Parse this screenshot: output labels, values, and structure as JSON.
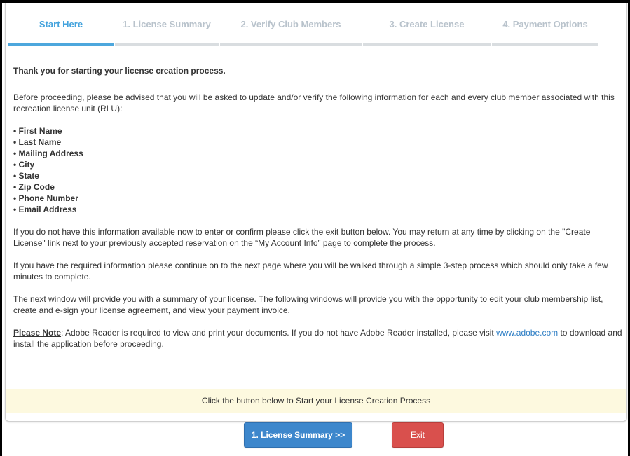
{
  "tabs": [
    {
      "label": "Start Here",
      "active": true
    },
    {
      "label": "1. License Summary",
      "active": false
    },
    {
      "label": "2. Verify Club Members",
      "active": false
    },
    {
      "label": "3. Create License",
      "active": false
    },
    {
      "label": "4. Payment Options",
      "active": false
    }
  ],
  "content": {
    "intro": "Thank you for starting your license creation process.",
    "advisory": "Before proceeding, please be advised that you will be asked to update and/or verify the following information for each and every club member associated with this recreation license unit (RLU):",
    "fields": [
      "• First Name",
      "• Last Name",
      "• Mailing Address",
      "• City",
      "• State",
      "• Zip Code",
      "• Phone Number",
      "• Email Address"
    ],
    "exit_info": "If you do not have this information available now to enter or confirm please click the exit button below. You may return at any time by clicking on the \"Create License\" link next to your previously accepted reservation on the “My Account Info” page to complete the process.",
    "continue_info": "If you have the required information please continue on to the next page where you will be walked through a simple 3-step process which should only take a few minutes to complete.",
    "next_window_info": "The next window will provide you with a summary of your license. The following windows will provide you with the opportunity to edit your club membership list, create and e-sign your license agreement, and view your payment invoice.",
    "note_label": "Please Note",
    "note_text": ": Adobe Reader is required to view and print your documents. If you do not have Adobe Reader installed, please visit ",
    "note_link": "www.adobe.com",
    "note_text_after": " to download and install the application before proceeding."
  },
  "banner": "Click the button below to Start your License Creation Process",
  "buttons": {
    "next_label": "1. License Summary >>",
    "exit_label": "Exit"
  },
  "colors": {
    "active_tab": "#44a3dd",
    "inactive_tab": "#b9c3cc",
    "primary_button": "#3d87cc",
    "exit_button": "#d9504d",
    "banner_bg": "#fdf9df",
    "link": "#2a7cc4"
  }
}
